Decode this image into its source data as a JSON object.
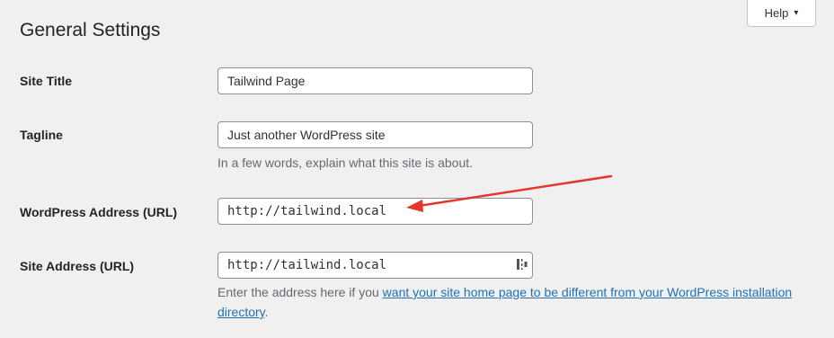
{
  "page": {
    "title": "General Settings",
    "help_label": "Help",
    "help_caret": "▾"
  },
  "settings": {
    "site_title": {
      "label": "Site Title",
      "value": "Tailwind Page"
    },
    "tagline": {
      "label": "Tagline",
      "value": "Just another WordPress site",
      "description": "In a few words, explain what this site is about."
    },
    "wordpress_address": {
      "label": "WordPress Address (URL)",
      "value": "http://tailwind.local"
    },
    "site_address": {
      "label": "Site Address (URL)",
      "value": "http://tailwind.local",
      "description_prefix": "Enter the address here if you ",
      "description_link": "want your site home page to be different from your WordPress installation directory",
      "description_suffix": "."
    }
  },
  "annotation": {
    "arrow_color": "#e8352b",
    "icon": "red-arrow-icon"
  },
  "colors": {
    "background": "#f0f0f1",
    "link": "#2271b1",
    "description_text": "#646970",
    "input_border": "#8c8f94"
  }
}
